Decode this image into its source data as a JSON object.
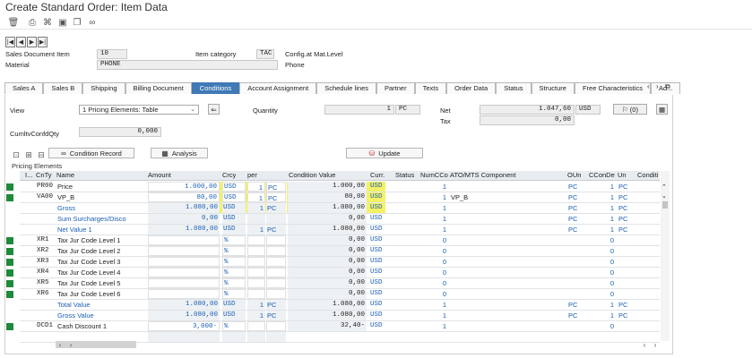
{
  "window_title": "Create Standard Order: Item Data",
  "toolbar_icons": [
    "trash-icon",
    "print-icon",
    "tree-icon",
    "folder-icon",
    "copy-icon",
    "glasses-icon"
  ],
  "nav_buttons": [
    "|◀",
    "◀",
    "▶",
    "▶|"
  ],
  "header": {
    "item_label": "Sales Document Item",
    "item_value": "10",
    "category_label": "Item category",
    "category_value": "TAC",
    "config_text": "Config.at Mat.Level",
    "material_label": "Material",
    "material_value": "PHONE",
    "material_desc": "Phone"
  },
  "tabs": [
    {
      "label": "Sales A",
      "active": false
    },
    {
      "label": "Sales B",
      "active": false
    },
    {
      "label": "Shipping",
      "active": false
    },
    {
      "label": "Billing Document",
      "active": false
    },
    {
      "label": "Conditions",
      "active": true
    },
    {
      "label": "Account Assignment",
      "active": false
    },
    {
      "label": "Schedule lines",
      "active": false
    },
    {
      "label": "Partner",
      "active": false
    },
    {
      "label": "Texts",
      "active": false
    },
    {
      "label": "Order Data",
      "active": false
    },
    {
      "label": "Status",
      "active": false
    },
    {
      "label": "Structure",
      "active": false
    },
    {
      "label": "Free Characteristics",
      "active": false
    },
    {
      "label": "Ad...",
      "active": false
    }
  ],
  "conditions": {
    "view_label": "View",
    "view_value": "1 Pricing Elements: Table",
    "quantity_label": "Quantity",
    "quantity_value": "1",
    "quantity_unit": "PC",
    "net_label": "Net",
    "net_value": "1.047,60",
    "net_currency": "USD",
    "tax_label": "Tax",
    "tax_value": "0,00",
    "zero_button": "(0)",
    "cumlt_label": "CumltvConfdQty",
    "cumlt_value": "0,000",
    "condition_record_label": "Condition Record",
    "analysis_label": "Analysis",
    "update_label": "Update"
  },
  "grid": {
    "title": "Pricing Elements",
    "columns": [
      "I...",
      "CnTy",
      "Name",
      "Amount",
      "Crcy",
      "per",
      "",
      "Condition Value",
      "Curr.",
      "Status",
      "NumCCo",
      "ATO/MTS Component",
      "OUn",
      "CConDe",
      "Un",
      "Conditi"
    ],
    "rows": [
      {
        "cnty": "PR00",
        "name": "Price",
        "amount": "1.000,00",
        "crcy": "USD",
        "per": "1",
        "uom": "PC",
        "value": "1.000,00",
        "curr": "USD",
        "num": "1",
        "ato": "",
        "oun": "PC",
        "ccon": "1",
        "un": "PC",
        "type": "input",
        "green": true
      },
      {
        "cnty": "VA00",
        "name": "VP_B",
        "amount": "80,00",
        "crcy": "USD",
        "per": "1",
        "uom": "PC",
        "value": "80,00",
        "curr": "USD",
        "num": "1",
        "ato": "VP_B",
        "oun": "PC",
        "ccon": "1",
        "un": "PC",
        "type": "input",
        "green": true
      },
      {
        "cnty": "",
        "name": "Gross",
        "amount": "1.080,00",
        "crcy": "USD",
        "per": "1",
        "uom": "PC",
        "value": "1.080,00",
        "curr": "USD",
        "num": "1",
        "ato": "",
        "oun": "PC",
        "ccon": "1",
        "un": "PC",
        "type": "sum",
        "green": false
      },
      {
        "cnty": "",
        "name": "Sum Surcharges/Disco",
        "amount": "0,00",
        "crcy": "USD",
        "per": "",
        "uom": "",
        "value": "0,00",
        "curr": "USD",
        "num": "1",
        "ato": "",
        "oun": "PC",
        "ccon": "1",
        "un": "PC",
        "type": "sum",
        "green": false
      },
      {
        "cnty": "",
        "name": "Net Value 1",
        "amount": "1.080,00",
        "crcy": "USD",
        "per": "1",
        "uom": "PC",
        "value": "1.080,00",
        "curr": "USD",
        "num": "1",
        "ato": "",
        "oun": "PC",
        "ccon": "1",
        "un": "PC",
        "type": "sum",
        "green": false
      },
      {
        "cnty": "XR1",
        "name": "Tax Jur Code Level 1",
        "amount": "",
        "crcy": "%",
        "per": "",
        "uom": "",
        "value": "0,00",
        "curr": "USD",
        "num": "0",
        "ato": "",
        "oun": "",
        "ccon": "0",
        "un": "",
        "type": "input",
        "green": true
      },
      {
        "cnty": "XR2",
        "name": "Tax Jur Code Level 2",
        "amount": "",
        "crcy": "%",
        "per": "",
        "uom": "",
        "value": "0,00",
        "curr": "USD",
        "num": "0",
        "ato": "",
        "oun": "",
        "ccon": "0",
        "un": "",
        "type": "input",
        "green": true
      },
      {
        "cnty": "XR3",
        "name": "Tax Jur Code Level 3",
        "amount": "",
        "crcy": "%",
        "per": "",
        "uom": "",
        "value": "0,00",
        "curr": "USD",
        "num": "0",
        "ato": "",
        "oun": "",
        "ccon": "0",
        "un": "",
        "type": "input",
        "green": true
      },
      {
        "cnty": "XR4",
        "name": "Tax Jur Code Level 4",
        "amount": "",
        "crcy": "%",
        "per": "",
        "uom": "",
        "value": "0,00",
        "curr": "USD",
        "num": "0",
        "ato": "",
        "oun": "",
        "ccon": "0",
        "un": "",
        "type": "input",
        "green": true
      },
      {
        "cnty": "XR5",
        "name": "Tax Jur Code Level 5",
        "amount": "",
        "crcy": "%",
        "per": "",
        "uom": "",
        "value": "0,00",
        "curr": "USD",
        "num": "0",
        "ato": "",
        "oun": "",
        "ccon": "0",
        "un": "",
        "type": "input",
        "green": true
      },
      {
        "cnty": "XR6",
        "name": "Tax Jur Code Level 6",
        "amount": "",
        "crcy": "%",
        "per": "",
        "uom": "",
        "value": "0,00",
        "curr": "USD",
        "num": "0",
        "ato": "",
        "oun": "",
        "ccon": "0",
        "un": "",
        "type": "input",
        "green": true
      },
      {
        "cnty": "",
        "name": "Total Value",
        "amount": "1.080,00",
        "crcy": "USD",
        "per": "1",
        "uom": "PC",
        "value": "1.080,00",
        "curr": "USD",
        "num": "1",
        "ato": "",
        "oun": "PC",
        "ccon": "1",
        "un": "PC",
        "type": "sum",
        "green": false
      },
      {
        "cnty": "",
        "name": "Gross Value",
        "amount": "1.080,00",
        "crcy": "USD",
        "per": "1",
        "uom": "PC",
        "value": "1.080,00",
        "curr": "USD",
        "num": "1",
        "ato": "",
        "oun": "PC",
        "ccon": "1",
        "un": "PC",
        "type": "sum",
        "green": false
      },
      {
        "cnty": "DCD1",
        "name": "Cash Discount 1",
        "amount": "3,000-",
        "crcy": "%",
        "per": "",
        "uom": "",
        "value": "32,40-",
        "curr": "USD",
        "num": "1",
        "ato": "",
        "oun": "",
        "ccon": "0",
        "un": "",
        "type": "input",
        "green": true
      },
      {
        "cnty": "",
        "name": "",
        "amount": "",
        "crcy": "",
        "per": "",
        "uom": "",
        "value": "",
        "curr": "",
        "num": "",
        "ato": "",
        "oun": "",
        "ccon": "",
        "un": "",
        "type": "empty",
        "green": false
      }
    ]
  },
  "colors": {
    "highlight": "#f1ef4a",
    "tab_active": "#3f79b6",
    "status_green": "#1f8a3a",
    "link_blue": "#1a5fb4"
  }
}
